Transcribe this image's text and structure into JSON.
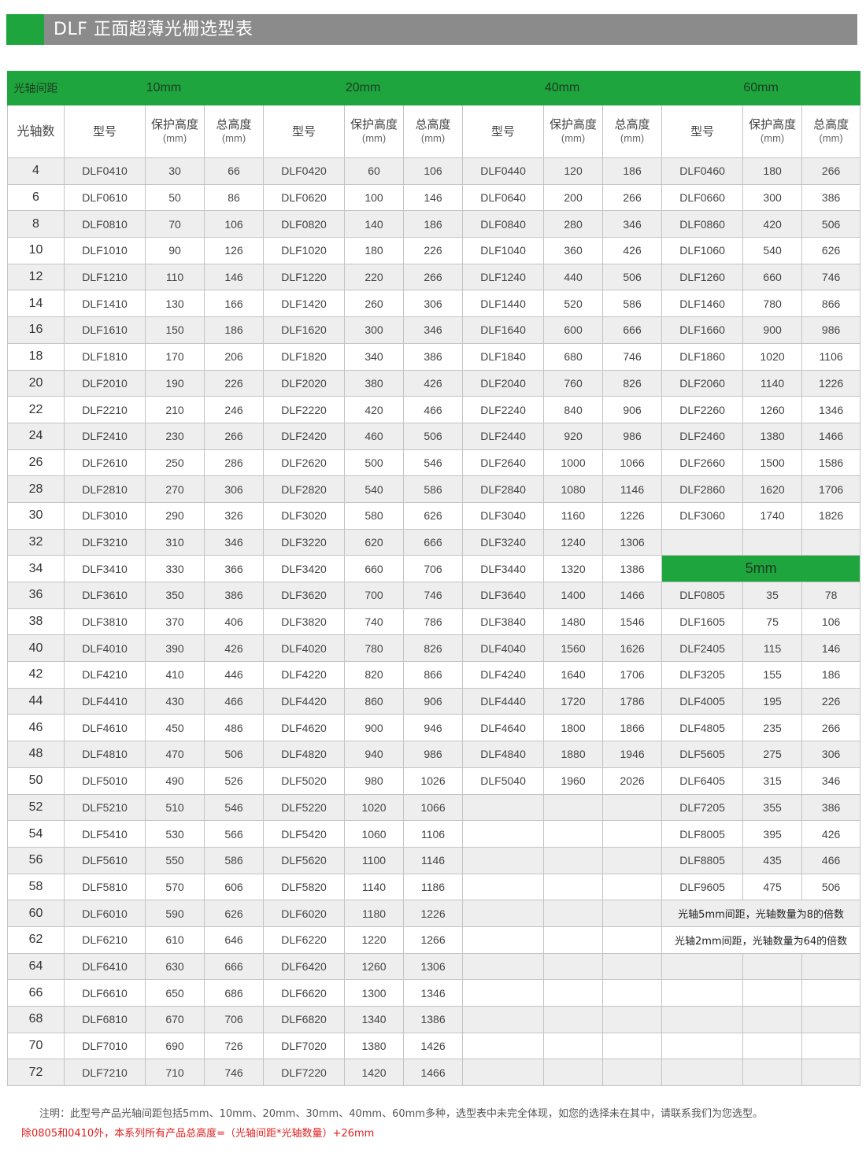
{
  "title": "DLF 正面超薄光栅选型表",
  "header": {
    "spacing_label": "光轴间距",
    "groups": [
      "10mm",
      "20mm",
      "40mm",
      "60mm"
    ],
    "count_label": "光轴数",
    "model_label": "型号",
    "protect_label": "保护高度",
    "total_label": "总高度",
    "unit": "(mm)"
  },
  "rows": [
    {
      "n": "4",
      "c": [
        [
          "DLF0410",
          "30",
          "66"
        ],
        [
          "DLF0420",
          "60",
          "106"
        ],
        [
          "DLF0440",
          "120",
          "186"
        ],
        [
          "DLF0460",
          "180",
          "266"
        ]
      ]
    },
    {
      "n": "6",
      "c": [
        [
          "DLF0610",
          "50",
          "86"
        ],
        [
          "DLF0620",
          "100",
          "146"
        ],
        [
          "DLF0640",
          "200",
          "266"
        ],
        [
          "DLF0660",
          "300",
          "386"
        ]
      ]
    },
    {
      "n": "8",
      "c": [
        [
          "DLF0810",
          "70",
          "106"
        ],
        [
          "DLF0820",
          "140",
          "186"
        ],
        [
          "DLF0840",
          "280",
          "346"
        ],
        [
          "DLF0860",
          "420",
          "506"
        ]
      ]
    },
    {
      "n": "10",
      "c": [
        [
          "DLF1010",
          "90",
          "126"
        ],
        [
          "DLF1020",
          "180",
          "226"
        ],
        [
          "DLF1040",
          "360",
          "426"
        ],
        [
          "DLF1060",
          "540",
          "626"
        ]
      ]
    },
    {
      "n": "12",
      "c": [
        [
          "DLF1210",
          "110",
          "146"
        ],
        [
          "DLF1220",
          "220",
          "266"
        ],
        [
          "DLF1240",
          "440",
          "506"
        ],
        [
          "DLF1260",
          "660",
          "746"
        ]
      ]
    },
    {
      "n": "14",
      "c": [
        [
          "DLF1410",
          "130",
          "166"
        ],
        [
          "DLF1420",
          "260",
          "306"
        ],
        [
          "DLF1440",
          "520",
          "586"
        ],
        [
          "DLF1460",
          "780",
          "866"
        ]
      ]
    },
    {
      "n": "16",
      "c": [
        [
          "DLF1610",
          "150",
          "186"
        ],
        [
          "DLF1620",
          "300",
          "346"
        ],
        [
          "DLF1640",
          "600",
          "666"
        ],
        [
          "DLF1660",
          "900",
          "986"
        ]
      ]
    },
    {
      "n": "18",
      "c": [
        [
          "DLF1810",
          "170",
          "206"
        ],
        [
          "DLF1820",
          "340",
          "386"
        ],
        [
          "DLF1840",
          "680",
          "746"
        ],
        [
          "DLF1860",
          "1020",
          "1106"
        ]
      ]
    },
    {
      "n": "20",
      "c": [
        [
          "DLF2010",
          "190",
          "226"
        ],
        [
          "DLF2020",
          "380",
          "426"
        ],
        [
          "DLF2040",
          "760",
          "826"
        ],
        [
          "DLF2060",
          "1140",
          "1226"
        ]
      ]
    },
    {
      "n": "22",
      "c": [
        [
          "DLF2210",
          "210",
          "246"
        ],
        [
          "DLF2220",
          "420",
          "466"
        ],
        [
          "DLF2240",
          "840",
          "906"
        ],
        [
          "DLF2260",
          "1260",
          "1346"
        ]
      ]
    },
    {
      "n": "24",
      "c": [
        [
          "DLF2410",
          "230",
          "266"
        ],
        [
          "DLF2420",
          "460",
          "506"
        ],
        [
          "DLF2440",
          "920",
          "986"
        ],
        [
          "DLF2460",
          "1380",
          "1466"
        ]
      ]
    },
    {
      "n": "26",
      "c": [
        [
          "DLF2610",
          "250",
          "286"
        ],
        [
          "DLF2620",
          "500",
          "546"
        ],
        [
          "DLF2640",
          "1000",
          "1066"
        ],
        [
          "DLF2660",
          "1500",
          "1586"
        ]
      ]
    },
    {
      "n": "28",
      "c": [
        [
          "DLF2810",
          "270",
          "306"
        ],
        [
          "DLF2820",
          "540",
          "586"
        ],
        [
          "DLF2840",
          "1080",
          "1146"
        ],
        [
          "DLF2860",
          "1620",
          "1706"
        ]
      ]
    },
    {
      "n": "30",
      "c": [
        [
          "DLF3010",
          "290",
          "326"
        ],
        [
          "DLF3020",
          "580",
          "626"
        ],
        [
          "DLF3040",
          "1160",
          "1226"
        ],
        [
          "DLF3060",
          "1740",
          "1826"
        ]
      ]
    },
    {
      "n": "32",
      "c": [
        [
          "DLF3210",
          "310",
          "346"
        ],
        [
          "DLF3220",
          "620",
          "666"
        ],
        [
          "DLF3240",
          "1240",
          "1306"
        ],
        [
          "",
          "",
          ""
        ]
      ]
    },
    {
      "n": "34",
      "c": [
        [
          "DLF3410",
          "330",
          "366"
        ],
        [
          "DLF3420",
          "660",
          "706"
        ],
        [
          "DLF3440",
          "1320",
          "1386"
        ]
      ],
      "sub": "5mm"
    },
    {
      "n": "36",
      "c": [
        [
          "DLF3610",
          "350",
          "386"
        ],
        [
          "DLF3620",
          "700",
          "746"
        ],
        [
          "DLF3640",
          "1400",
          "1466"
        ],
        [
          "DLF0805",
          "35",
          "78"
        ]
      ]
    },
    {
      "n": "38",
      "c": [
        [
          "DLF3810",
          "370",
          "406"
        ],
        [
          "DLF3820",
          "740",
          "786"
        ],
        [
          "DLF3840",
          "1480",
          "1546"
        ],
        [
          "DLF1605",
          "75",
          "106"
        ]
      ]
    },
    {
      "n": "40",
      "c": [
        [
          "DLF4010",
          "390",
          "426"
        ],
        [
          "DLF4020",
          "780",
          "826"
        ],
        [
          "DLF4040",
          "1560",
          "1626"
        ],
        [
          "DLF2405",
          "115",
          "146"
        ]
      ]
    },
    {
      "n": "42",
      "c": [
        [
          "DLF4210",
          "410",
          "446"
        ],
        [
          "DLF4220",
          "820",
          "866"
        ],
        [
          "DLF4240",
          "1640",
          "1706"
        ],
        [
          "DLF3205",
          "155",
          "186"
        ]
      ]
    },
    {
      "n": "44",
      "c": [
        [
          "DLF4410",
          "430",
          "466"
        ],
        [
          "DLF4420",
          "860",
          "906"
        ],
        [
          "DLF4440",
          "1720",
          "1786"
        ],
        [
          "DLF4005",
          "195",
          "226"
        ]
      ]
    },
    {
      "n": "46",
      "c": [
        [
          "DLF4610",
          "450",
          "486"
        ],
        [
          "DLF4620",
          "900",
          "946"
        ],
        [
          "DLF4640",
          "1800",
          "1866"
        ],
        [
          "DLF4805",
          "235",
          "266"
        ]
      ]
    },
    {
      "n": "48",
      "c": [
        [
          "DLF4810",
          "470",
          "506"
        ],
        [
          "DLF4820",
          "940",
          "986"
        ],
        [
          "DLF4840",
          "1880",
          "1946"
        ],
        [
          "DLF5605",
          "275",
          "306"
        ]
      ]
    },
    {
      "n": "50",
      "c": [
        [
          "DLF5010",
          "490",
          "526"
        ],
        [
          "DLF5020",
          "980",
          "1026"
        ],
        [
          "DLF5040",
          "1960",
          "2026"
        ],
        [
          "DLF6405",
          "315",
          "346"
        ]
      ]
    },
    {
      "n": "52",
      "c": [
        [
          "DLF5210",
          "510",
          "546"
        ],
        [
          "DLF5220",
          "1020",
          "1066"
        ],
        [
          "",
          "",
          ""
        ],
        [
          "DLF7205",
          "355",
          "386"
        ]
      ]
    },
    {
      "n": "54",
      "c": [
        [
          "DLF5410",
          "530",
          "566"
        ],
        [
          "DLF5420",
          "1060",
          "1106"
        ],
        [
          "",
          "",
          ""
        ],
        [
          "DLF8005",
          "395",
          "426"
        ]
      ]
    },
    {
      "n": "56",
      "c": [
        [
          "DLF5610",
          "550",
          "586"
        ],
        [
          "DLF5620",
          "1100",
          "1146"
        ],
        [
          "",
          "",
          ""
        ],
        [
          "DLF8805",
          "435",
          "466"
        ]
      ]
    },
    {
      "n": "58",
      "c": [
        [
          "DLF5810",
          "570",
          "606"
        ],
        [
          "DLF5820",
          "1140",
          "1186"
        ],
        [
          "",
          "",
          ""
        ],
        [
          "DLF9605",
          "475",
          "506"
        ]
      ]
    },
    {
      "n": "60",
      "c": [
        [
          "DLF6010",
          "590",
          "626"
        ],
        [
          "DLF6020",
          "1180",
          "1226"
        ],
        [
          "",
          "",
          ""
        ]
      ],
      "note": "光轴5mm间距，光轴数量为8的倍数"
    },
    {
      "n": "62",
      "c": [
        [
          "DLF6210",
          "610",
          "646"
        ],
        [
          "DLF6220",
          "1220",
          "1266"
        ],
        [
          "",
          "",
          ""
        ]
      ],
      "note": "光轴2mm间距，光轴数量为64的倍数"
    },
    {
      "n": "64",
      "c": [
        [
          "DLF6410",
          "630",
          "666"
        ],
        [
          "DLF6420",
          "1260",
          "1306"
        ],
        [
          "",
          "",
          ""
        ],
        [
          "",
          "",
          ""
        ]
      ]
    },
    {
      "n": "66",
      "c": [
        [
          "DLF6610",
          "650",
          "686"
        ],
        [
          "DLF6620",
          "1300",
          "1346"
        ],
        [
          "",
          "",
          ""
        ],
        [
          "",
          "",
          ""
        ]
      ]
    },
    {
      "n": "68",
      "c": [
        [
          "DLF6810",
          "670",
          "706"
        ],
        [
          "DLF6820",
          "1340",
          "1386"
        ],
        [
          "",
          "",
          ""
        ],
        [
          "",
          "",
          ""
        ]
      ]
    },
    {
      "n": "70",
      "c": [
        [
          "DLF7010",
          "690",
          "726"
        ],
        [
          "DLF7020",
          "1380",
          "1426"
        ],
        [
          "",
          "",
          ""
        ],
        [
          "",
          "",
          ""
        ]
      ]
    },
    {
      "n": "72",
      "c": [
        [
          "DLF7210",
          "710",
          "746"
        ],
        [
          "DLF7220",
          "1420",
          "1466"
        ],
        [
          "",
          "",
          ""
        ],
        [
          "",
          "",
          ""
        ]
      ]
    }
  ],
  "footnote": "注明：此型号产品光轴间距包括5mm、10mm、20mm、30mm、40mm、60mm多种，选型表中未完全体现，如您的选择未在其中，请联系我们为您选型。",
  "footnote_red": "除0805和0410外，本系列所有产品总高度=（光轴间距*光轴数量）+26mm",
  "colors": {
    "accent": "#1ea53e",
    "title_bar": "#8b8b8b",
    "row_alt": "#eeeeee",
    "red_note": "#e02020"
  }
}
